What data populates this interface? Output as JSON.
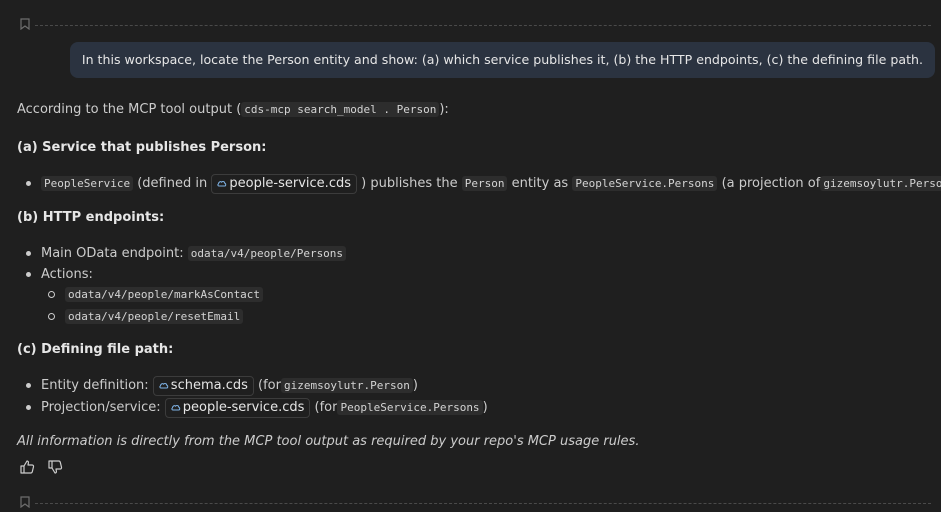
{
  "user_message": "In this workspace, locate the Person entity and show: (a) which service publishes it, (b) the HTTP endpoints, (c) the defining file path.",
  "response": {
    "intro_prefix": "According to the MCP tool output (",
    "intro_code": "cds-mcp search_model . Person",
    "intro_suffix": "):",
    "section_a": {
      "heading": "(a) Service that publishes Person:",
      "item": {
        "service_code": "PeopleService",
        "t1": "(defined in",
        "file": "people-service.cds",
        "t2": ") publishes the",
        "entity_code": "Person",
        "t3": "entity as",
        "projection_code": "PeopleService.Persons",
        "t4": "(a projection of",
        "source_code": "gizemsoylutr.Person",
        "t5": ")."
      }
    },
    "section_b": {
      "heading": "(b) HTTP endpoints:",
      "main_label": "Main OData endpoint:",
      "main_code": "odata/v4/people/Persons",
      "actions_label": "Actions:",
      "action_1": "odata/v4/people/markAsContact",
      "action_2": "odata/v4/people/resetEmail"
    },
    "section_c": {
      "heading": "(c) Defining file path:",
      "entity_label": "Entity definition:",
      "entity_file": "schema.cds",
      "entity_for": "(for",
      "entity_code": "gizemsoylutr.Person",
      "close": ")",
      "proj_label": "Projection/service:",
      "proj_file": "people-service.cds",
      "proj_for": "(for",
      "proj_code": "PeopleService.Persons"
    },
    "note": "All information is directly from the MCP tool output as required by your repo's MCP usage rules."
  },
  "icons": {
    "bookmark": "bookmark-icon",
    "cds_file": "cds-file-icon",
    "thumbs_up": "thumbs-up-icon",
    "thumbs_down": "thumbs-down-icon"
  }
}
